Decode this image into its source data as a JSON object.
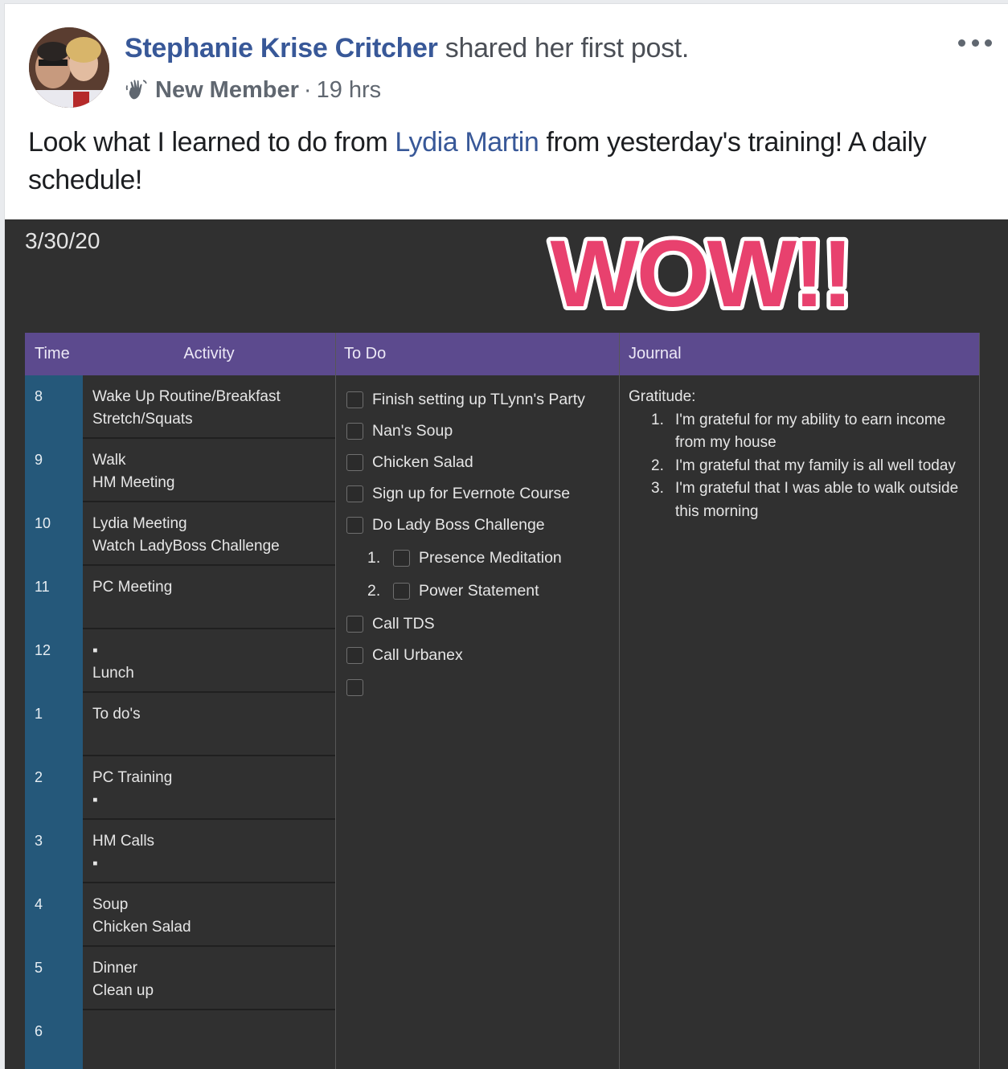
{
  "post": {
    "author": "Stephanie Krise Critcher",
    "action": " shared her first post.",
    "badge": "New Member",
    "separator": "·",
    "time": "19 hrs",
    "text_before": "Look what I learned to do from ",
    "mention": "Lydia Martin",
    "text_after": " from yesterday's training! A daily schedule!",
    "more_icon": "ellipsis-icon",
    "badge_icon": "waving-hand-icon"
  },
  "image": {
    "date": "3/30/20",
    "overlay_text": "WOW!!",
    "colors": {
      "header_purple": "#5c4a8e",
      "time_column_blue": "#25587a",
      "background": "#303030",
      "wow_pink": "#e8416e"
    },
    "headers": {
      "time": "Time",
      "activity": "Activity",
      "todo": "To Do",
      "journal": "Journal"
    },
    "schedule": [
      {
        "time": "8",
        "line1": "Wake Up Routine/Breakfast",
        "line2": "Stretch/Squats"
      },
      {
        "time": "9",
        "line1": "Walk",
        "line2": "HM Meeting"
      },
      {
        "time": "10",
        "line1": "Lydia Meeting",
        "line2": "Watch LadyBoss Challenge"
      },
      {
        "time": "11",
        "line1": "",
        "line2": "PC Meeting"
      },
      {
        "time": "12",
        "line1": "▪",
        "line2": "Lunch"
      },
      {
        "time": "1",
        "line1": "To do's",
        "line2": ""
      },
      {
        "time": "2",
        "line1": "PC Training",
        "line2": "▪"
      },
      {
        "time": "3",
        "line1": "HM Calls",
        "line2": "▪"
      },
      {
        "time": "4",
        "line1": "Soup",
        "line2": "Chicken Salad"
      },
      {
        "time": "5",
        "line1": "Dinner",
        "line2": "Clean up"
      },
      {
        "time": "6",
        "line1": "",
        "line2": ""
      }
    ],
    "todos": [
      {
        "num": "",
        "label": "Finish setting up TLynn's Party"
      },
      {
        "num": "",
        "label": "Nan's Soup"
      },
      {
        "num": "",
        "label": "Chicken Salad"
      },
      {
        "num": "",
        "label": "Sign up for Evernote Course"
      },
      {
        "num": "",
        "label": "Do Lady Boss Challenge"
      },
      {
        "num": "1.",
        "label": "Presence Meditation"
      },
      {
        "num": "2.",
        "label": "Power Statement"
      },
      {
        "num": "",
        "label": "Call TDS"
      },
      {
        "num": "",
        "label": "Call Urbanex"
      },
      {
        "num": "",
        "label": ""
      }
    ],
    "journal": {
      "heading": "Gratitude:",
      "items": [
        {
          "n": "1.",
          "text": "I'm grateful for my ability to earn income from my house"
        },
        {
          "n": "2.",
          "text": "I'm grateful that my family is all well today"
        },
        {
          "n": "3.",
          "text": "I'm grateful that I was able to walk outside this morning"
        }
      ]
    }
  }
}
